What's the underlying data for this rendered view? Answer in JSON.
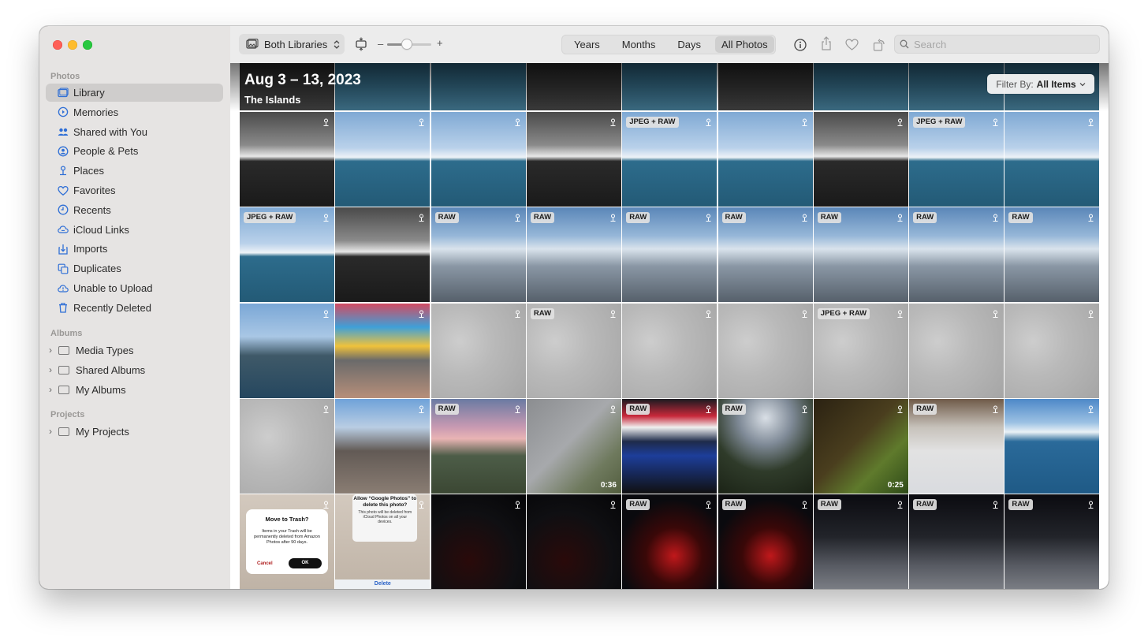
{
  "sidebar": {
    "sections": [
      {
        "title": "Photos",
        "items": [
          {
            "label": "Library",
            "icon": "photo-library-icon",
            "selected": true
          },
          {
            "label": "Memories",
            "icon": "memories-icon"
          },
          {
            "label": "Shared with You",
            "icon": "shared-with-you-icon"
          },
          {
            "label": "People & Pets",
            "icon": "people-icon"
          },
          {
            "label": "Places",
            "icon": "places-pin-icon"
          },
          {
            "label": "Favorites",
            "icon": "heart-icon"
          },
          {
            "label": "Recents",
            "icon": "clock-icon"
          },
          {
            "label": "iCloud Links",
            "icon": "cloud-link-icon"
          },
          {
            "label": "Imports",
            "icon": "import-icon"
          },
          {
            "label": "Duplicates",
            "icon": "duplicates-icon"
          },
          {
            "label": "Unable to Upload",
            "icon": "cloud-alert-icon"
          },
          {
            "label": "Recently Deleted",
            "icon": "trash-icon"
          }
        ]
      },
      {
        "title": "Albums",
        "items": [
          {
            "label": "Media Types"
          },
          {
            "label": "Shared Albums"
          },
          {
            "label": "My Albums"
          }
        ]
      },
      {
        "title": "Projects",
        "items": [
          {
            "label": "My Projects"
          }
        ]
      }
    ]
  },
  "toolbar": {
    "library_select": "Both Libraries",
    "zoom_minus": "–",
    "zoom_plus": "+",
    "zoom_level": 0.45,
    "segments": [
      "Years",
      "Months",
      "Days",
      "All Photos"
    ],
    "active_segment": "All Photos",
    "search_placeholder": "Search"
  },
  "grid": {
    "date_title": "Aug 3 – 13, 2023",
    "location": "The Islands",
    "filter_prefix": "Filter By:",
    "filter_value": "All Items",
    "rows": [
      [
        {
          "style": "sky-bw"
        },
        {
          "style": "sky-blue"
        },
        {
          "style": "sky-blue"
        },
        {
          "style": "sky-bw"
        },
        {
          "style": "sky-blue",
          "badge": "JPEG + RAW"
        },
        {
          "style": "sky-blue"
        },
        {
          "style": "sky-bw"
        },
        {
          "style": "sky-blue",
          "badge": "JPEG + RAW"
        },
        {
          "style": "sky-blue"
        }
      ],
      [
        {
          "style": "sky-blue",
          "badge": "JPEG + RAW"
        },
        {
          "style": "sky-bw"
        },
        {
          "style": "ferry",
          "badge": "RAW"
        },
        {
          "style": "ferry",
          "badge": "RAW"
        },
        {
          "style": "ferry",
          "badge": "RAW"
        },
        {
          "style": "ferry",
          "badge": "RAW"
        },
        {
          "style": "ferry",
          "badge": "RAW"
        },
        {
          "style": "ferry",
          "badge": "RAW"
        },
        {
          "style": "ferry",
          "badge": "RAW"
        }
      ],
      [
        {
          "style": "harbor"
        },
        {
          "style": "umbrella"
        },
        {
          "style": "sand"
        },
        {
          "style": "sand",
          "badge": "RAW"
        },
        {
          "style": "sand"
        },
        {
          "style": "sand"
        },
        {
          "style": "sand",
          "badge": "JPEG + RAW"
        },
        {
          "style": "sand"
        },
        {
          "style": "sand"
        }
      ],
      [
        {
          "style": "sand"
        },
        {
          "style": "street"
        },
        {
          "style": "dusk",
          "badge": "RAW"
        },
        {
          "style": "stone",
          "duration": "0:36"
        },
        {
          "style": "boats",
          "badge": "RAW"
        },
        {
          "style": "evening",
          "badge": "RAW"
        },
        {
          "style": "grass",
          "duration": "0:25"
        },
        {
          "style": "desk",
          "badge": "RAW"
        },
        {
          "style": "bay"
        }
      ],
      [
        {
          "style": "phone",
          "dialog": "trash"
        },
        {
          "style": "phone",
          "dialog": "google"
        },
        {
          "style": "night"
        },
        {
          "style": "night"
        },
        {
          "style": "nightred",
          "badge": "RAW"
        },
        {
          "style": "nightred",
          "badge": "RAW"
        },
        {
          "style": "road",
          "badge": "RAW"
        },
        {
          "style": "road",
          "badge": "RAW"
        },
        {
          "style": "road",
          "badge": "RAW"
        }
      ]
    ],
    "dialog_trash": {
      "title": "Move to Trash?",
      "message": "Items in your Trash will be permanently deleted from Amazon Photos after 90 days.",
      "cancel": "Cancel",
      "ok": "OK"
    },
    "dialog_google": {
      "title": "Allow “Google Photos” to delete this photo?",
      "message": "This photo will be deleted from iCloud Photos on all your devices.",
      "delete": "Delete"
    }
  }
}
